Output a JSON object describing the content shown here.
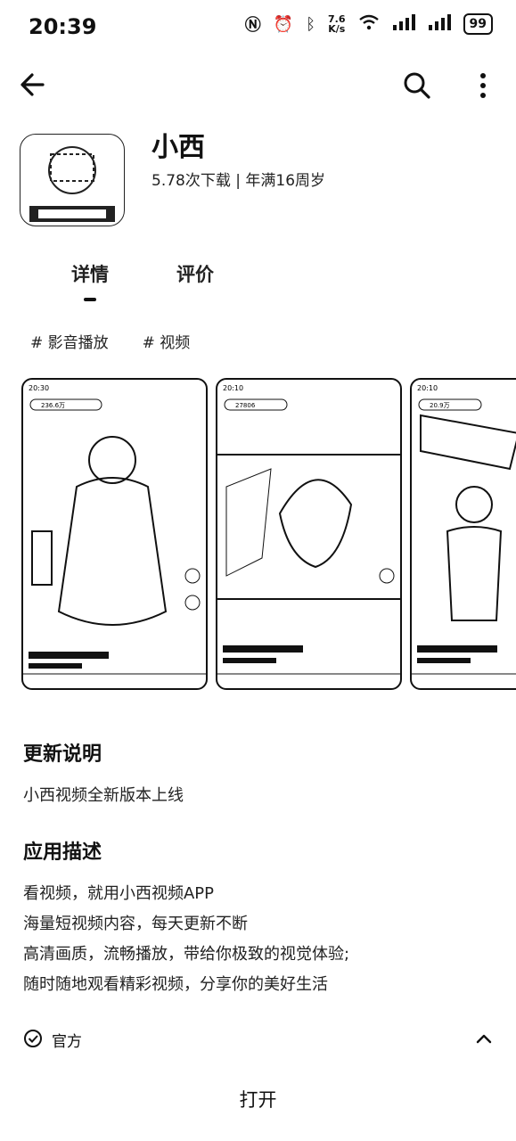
{
  "status_bar": {
    "time": "20:39",
    "net_speed_value": "7.6",
    "net_speed_unit": "K/s",
    "battery": "99"
  },
  "app": {
    "name": "小西",
    "meta": "5.78次下载 | 年满16周岁"
  },
  "tabs": [
    {
      "label": "详情",
      "active": true
    },
    {
      "label": "评价",
      "active": false
    }
  ],
  "tags": [
    "# 影音播放",
    "# 视频"
  ],
  "screenshots": [
    {
      "time": "20:30",
      "count": "236.6万"
    },
    {
      "time": "20:10",
      "count": "27806"
    },
    {
      "time": "20:10",
      "count": "20.9万"
    }
  ],
  "update_notes": {
    "title": "更新说明",
    "text": "小西视频全新版本上线"
  },
  "description": {
    "title": "应用描述",
    "lines": [
      "看视频，就用小西视频APP",
      "海量短视频内容，每天更新不断",
      "高清画质，流畅播放，带给你极致的视觉体验;",
      "随时随地观看精彩视频，分享你的美好生活"
    ]
  },
  "official": {
    "label": "官方"
  },
  "open_button": "打开",
  "colors": {
    "text": "#111111",
    "background": "#ffffff"
  },
  "icons": [
    "back-arrow-icon",
    "search-icon",
    "more-vertical-icon",
    "check-circle-icon",
    "chevron-up-icon"
  ]
}
